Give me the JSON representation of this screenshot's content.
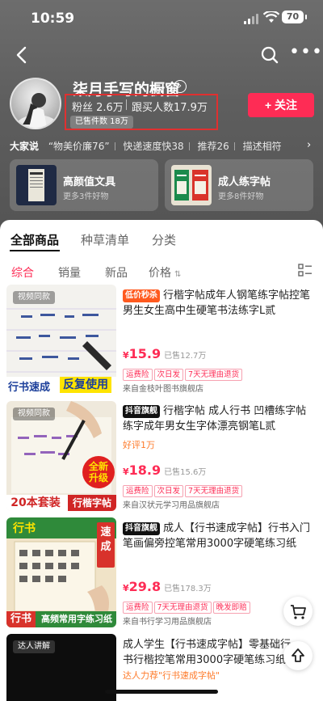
{
  "status": {
    "time": "10:59",
    "battery": "70"
  },
  "shop": {
    "name": "柒月手写的橱窗",
    "fans": "粉丝 2.6万",
    "buyers": "跟买人数17.9万",
    "sold": "已售件数 18万",
    "follow_label": "+ 关注"
  },
  "reviews": {
    "head": "大家说",
    "items": [
      "“物美价廉76”",
      "快递速度快38",
      "推荐26",
      "描述相符"
    ]
  },
  "collections": [
    {
      "title": "高颜值文具",
      "sub": "更多3件好物"
    },
    {
      "title": "成人练字帖",
      "sub": "更多8件好物"
    }
  ],
  "tabs": [
    "全部商品",
    "种草清单",
    "分类"
  ],
  "sort": [
    "综合",
    "销量",
    "新品",
    "价格"
  ],
  "products": [
    {
      "image_tag": "视频同款",
      "image_caption_left": "行书速成",
      "image_caption_right": "反复使用",
      "badge": "低价秒杀",
      "title": "行楷字帖成年人钢笔练字帖控笔男生女生高中生硬笔书法练字L贰",
      "price_symbol": "¥",
      "price": "15.9",
      "sold": "已售12.7万",
      "tags": [
        "运费险",
        "次日发",
        "7天无理由退货"
      ],
      "store": "来自金枝叶图书旗舰店",
      "sub_line": ""
    },
    {
      "image_tag": "视频同款",
      "image_caption_left": "20本套装",
      "image_caption_right": "行楷字帖",
      "image_burst": "全新升级",
      "badge": "抖音旗舰",
      "title": "行楷字帖 成人行书 凹槽练字帖练字成年男女生字体漂亮钢笔L贰",
      "price_symbol": "¥",
      "price": "18.9",
      "sold": "已售15.6万",
      "tags": [
        "运费险",
        "次日发",
        "7天无理由退货"
      ],
      "store": "来自汉状元学习用品旗舰店",
      "sub_line": "好评1万"
    },
    {
      "image_tag": "",
      "image_caption_left": "行书",
      "image_caption_right": "高频常用字练习纸",
      "image_burst": "速成",
      "image_top": "行书",
      "badge": "抖音旗舰",
      "title": "成人【行书速成字帖】行书入门笔画偏旁控笔常用3000字硬笔练习纸",
      "price_symbol": "¥",
      "price": "29.8",
      "sold": "已售178.3万",
      "tags": [
        "运费险",
        "7天无理由退货",
        "晚发即赔"
      ],
      "store": "来自书行学习用品旗舰店",
      "sub_line": ""
    },
    {
      "image_tag": "达人讲解",
      "badge": "",
      "title": "成人学生【行书速成字帖】零基础行书行楷控笔常用3000字硬笔练习纸",
      "sub_line": "达人力荐\"行书速成字帖\""
    }
  ],
  "colors": {
    "accent": "#fe2c55",
    "badge_sale": "#ff5a1f",
    "badge_flagship": "#111111"
  }
}
